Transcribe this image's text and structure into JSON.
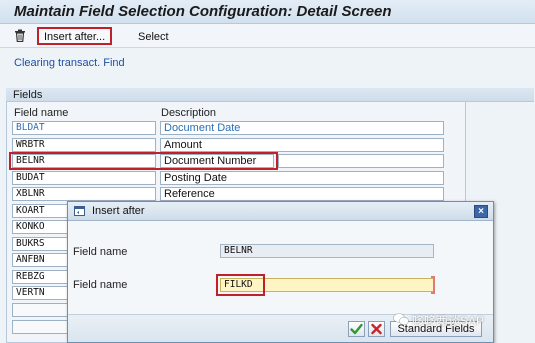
{
  "window": {
    "title": "Maintain Field Selection Configuration: Detail Screen"
  },
  "toolbar": {
    "delete_icon": "trash-icon",
    "insert_label": "Insert after...",
    "select_label": "Select"
  },
  "context_link": "Clearing transact. Find",
  "fields_group": {
    "title": "Fields",
    "col_field": "Field name",
    "col_desc": "Description",
    "rows": [
      {
        "field": "BLDAT",
        "desc": "Document Date"
      },
      {
        "field": "WRBTR",
        "desc": "Amount"
      },
      {
        "field": "BELNR",
        "desc": "Document Number"
      },
      {
        "field": "BUDAT",
        "desc": "Posting Date"
      },
      {
        "field": "XBLNR",
        "desc": "Reference"
      },
      {
        "field": "KOART",
        "desc": ""
      },
      {
        "field": "KONKO",
        "desc": ""
      },
      {
        "field": "BUKRS",
        "desc": ""
      },
      {
        "field": "ANFBN",
        "desc": ""
      },
      {
        "field": "REBZG",
        "desc": ""
      },
      {
        "field": "VERTN",
        "desc": ""
      },
      {
        "field": "",
        "desc": ""
      },
      {
        "field": "",
        "desc": ""
      }
    ]
  },
  "dialog": {
    "title": "Insert after",
    "title_icon": "dialog-icon",
    "close_icon": "close-icon",
    "ref_label": "Field name",
    "ref_value": "BELNR",
    "new_label": "Field name",
    "new_value": "FILKD",
    "ok_icon": "check-icon",
    "cancel_icon": "cancel-icon",
    "standard_fields_label": "Standard Fields"
  },
  "watermark": {
    "text": "哆哆西谈SAP"
  },
  "colors": {
    "highlight": "#c0202a",
    "link": "#1f4e9e",
    "blue_text": "#2b6fb6",
    "input_bg": "#fff5c4"
  }
}
